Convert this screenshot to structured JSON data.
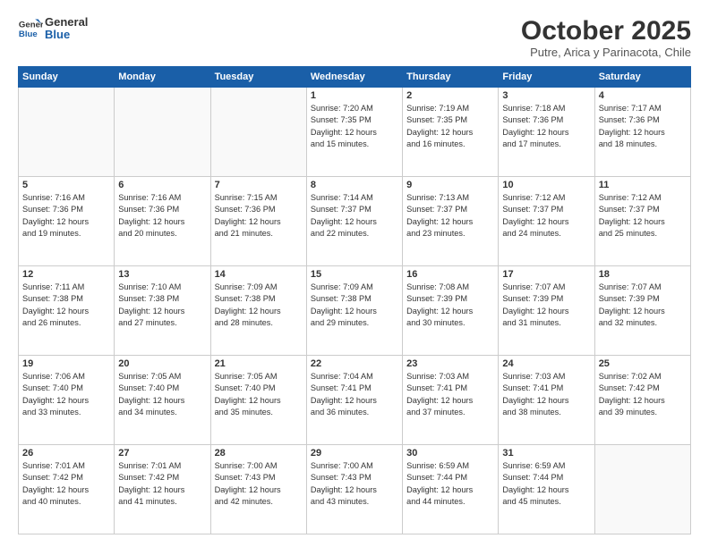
{
  "header": {
    "logo_line1": "General",
    "logo_line2": "Blue",
    "month": "October 2025",
    "location": "Putre, Arica y Parinacota, Chile"
  },
  "weekdays": [
    "Sunday",
    "Monday",
    "Tuesday",
    "Wednesday",
    "Thursday",
    "Friday",
    "Saturday"
  ],
  "weeks": [
    [
      {
        "day": "",
        "info": ""
      },
      {
        "day": "",
        "info": ""
      },
      {
        "day": "",
        "info": ""
      },
      {
        "day": "1",
        "info": "Sunrise: 7:20 AM\nSunset: 7:35 PM\nDaylight: 12 hours\nand 15 minutes."
      },
      {
        "day": "2",
        "info": "Sunrise: 7:19 AM\nSunset: 7:35 PM\nDaylight: 12 hours\nand 16 minutes."
      },
      {
        "day": "3",
        "info": "Sunrise: 7:18 AM\nSunset: 7:36 PM\nDaylight: 12 hours\nand 17 minutes."
      },
      {
        "day": "4",
        "info": "Sunrise: 7:17 AM\nSunset: 7:36 PM\nDaylight: 12 hours\nand 18 minutes."
      }
    ],
    [
      {
        "day": "5",
        "info": "Sunrise: 7:16 AM\nSunset: 7:36 PM\nDaylight: 12 hours\nand 19 minutes."
      },
      {
        "day": "6",
        "info": "Sunrise: 7:16 AM\nSunset: 7:36 PM\nDaylight: 12 hours\nand 20 minutes."
      },
      {
        "day": "7",
        "info": "Sunrise: 7:15 AM\nSunset: 7:36 PM\nDaylight: 12 hours\nand 21 minutes."
      },
      {
        "day": "8",
        "info": "Sunrise: 7:14 AM\nSunset: 7:37 PM\nDaylight: 12 hours\nand 22 minutes."
      },
      {
        "day": "9",
        "info": "Sunrise: 7:13 AM\nSunset: 7:37 PM\nDaylight: 12 hours\nand 23 minutes."
      },
      {
        "day": "10",
        "info": "Sunrise: 7:12 AM\nSunset: 7:37 PM\nDaylight: 12 hours\nand 24 minutes."
      },
      {
        "day": "11",
        "info": "Sunrise: 7:12 AM\nSunset: 7:37 PM\nDaylight: 12 hours\nand 25 minutes."
      }
    ],
    [
      {
        "day": "12",
        "info": "Sunrise: 7:11 AM\nSunset: 7:38 PM\nDaylight: 12 hours\nand 26 minutes."
      },
      {
        "day": "13",
        "info": "Sunrise: 7:10 AM\nSunset: 7:38 PM\nDaylight: 12 hours\nand 27 minutes."
      },
      {
        "day": "14",
        "info": "Sunrise: 7:09 AM\nSunset: 7:38 PM\nDaylight: 12 hours\nand 28 minutes."
      },
      {
        "day": "15",
        "info": "Sunrise: 7:09 AM\nSunset: 7:38 PM\nDaylight: 12 hours\nand 29 minutes."
      },
      {
        "day": "16",
        "info": "Sunrise: 7:08 AM\nSunset: 7:39 PM\nDaylight: 12 hours\nand 30 minutes."
      },
      {
        "day": "17",
        "info": "Sunrise: 7:07 AM\nSunset: 7:39 PM\nDaylight: 12 hours\nand 31 minutes."
      },
      {
        "day": "18",
        "info": "Sunrise: 7:07 AM\nSunset: 7:39 PM\nDaylight: 12 hours\nand 32 minutes."
      }
    ],
    [
      {
        "day": "19",
        "info": "Sunrise: 7:06 AM\nSunset: 7:40 PM\nDaylight: 12 hours\nand 33 minutes."
      },
      {
        "day": "20",
        "info": "Sunrise: 7:05 AM\nSunset: 7:40 PM\nDaylight: 12 hours\nand 34 minutes."
      },
      {
        "day": "21",
        "info": "Sunrise: 7:05 AM\nSunset: 7:40 PM\nDaylight: 12 hours\nand 35 minutes."
      },
      {
        "day": "22",
        "info": "Sunrise: 7:04 AM\nSunset: 7:41 PM\nDaylight: 12 hours\nand 36 minutes."
      },
      {
        "day": "23",
        "info": "Sunrise: 7:03 AM\nSunset: 7:41 PM\nDaylight: 12 hours\nand 37 minutes."
      },
      {
        "day": "24",
        "info": "Sunrise: 7:03 AM\nSunset: 7:41 PM\nDaylight: 12 hours\nand 38 minutes."
      },
      {
        "day": "25",
        "info": "Sunrise: 7:02 AM\nSunset: 7:42 PM\nDaylight: 12 hours\nand 39 minutes."
      }
    ],
    [
      {
        "day": "26",
        "info": "Sunrise: 7:01 AM\nSunset: 7:42 PM\nDaylight: 12 hours\nand 40 minutes."
      },
      {
        "day": "27",
        "info": "Sunrise: 7:01 AM\nSunset: 7:42 PM\nDaylight: 12 hours\nand 41 minutes."
      },
      {
        "day": "28",
        "info": "Sunrise: 7:00 AM\nSunset: 7:43 PM\nDaylight: 12 hours\nand 42 minutes."
      },
      {
        "day": "29",
        "info": "Sunrise: 7:00 AM\nSunset: 7:43 PM\nDaylight: 12 hours\nand 43 minutes."
      },
      {
        "day": "30",
        "info": "Sunrise: 6:59 AM\nSunset: 7:44 PM\nDaylight: 12 hours\nand 44 minutes."
      },
      {
        "day": "31",
        "info": "Sunrise: 6:59 AM\nSunset: 7:44 PM\nDaylight: 12 hours\nand 45 minutes."
      },
      {
        "day": "",
        "info": ""
      }
    ]
  ]
}
